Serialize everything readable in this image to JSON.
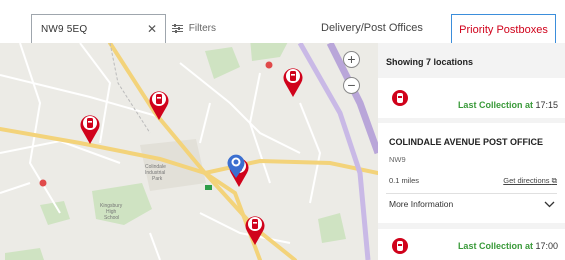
{
  "search": {
    "value": "NW9 5EQ"
  },
  "filters_label": "Filters",
  "tabs": {
    "delivery": "Delivery/Post Offices",
    "priority": "Priority Postboxes"
  },
  "panel": {
    "showing": "Showing 7 locations",
    "items": [
      {
        "label": "Last Collection at",
        "time": "17:15"
      },
      {
        "label": "Last Collection at",
        "time": "17:00"
      }
    ],
    "office": {
      "name": "COLINDALE AVENUE POST OFFICE",
      "postcode": "NW9",
      "distance": "0.1 miles",
      "directions": "Get directions",
      "more_info": "More Information"
    }
  },
  "map": {
    "labels": {
      "park": "Colindale Industrial Park",
      "school": "Kingsbury High School"
    }
  },
  "colors": {
    "brand_red": "#d0021b",
    "accent_blue": "#3b8edb",
    "collection_green": "#3a9a3a"
  }
}
